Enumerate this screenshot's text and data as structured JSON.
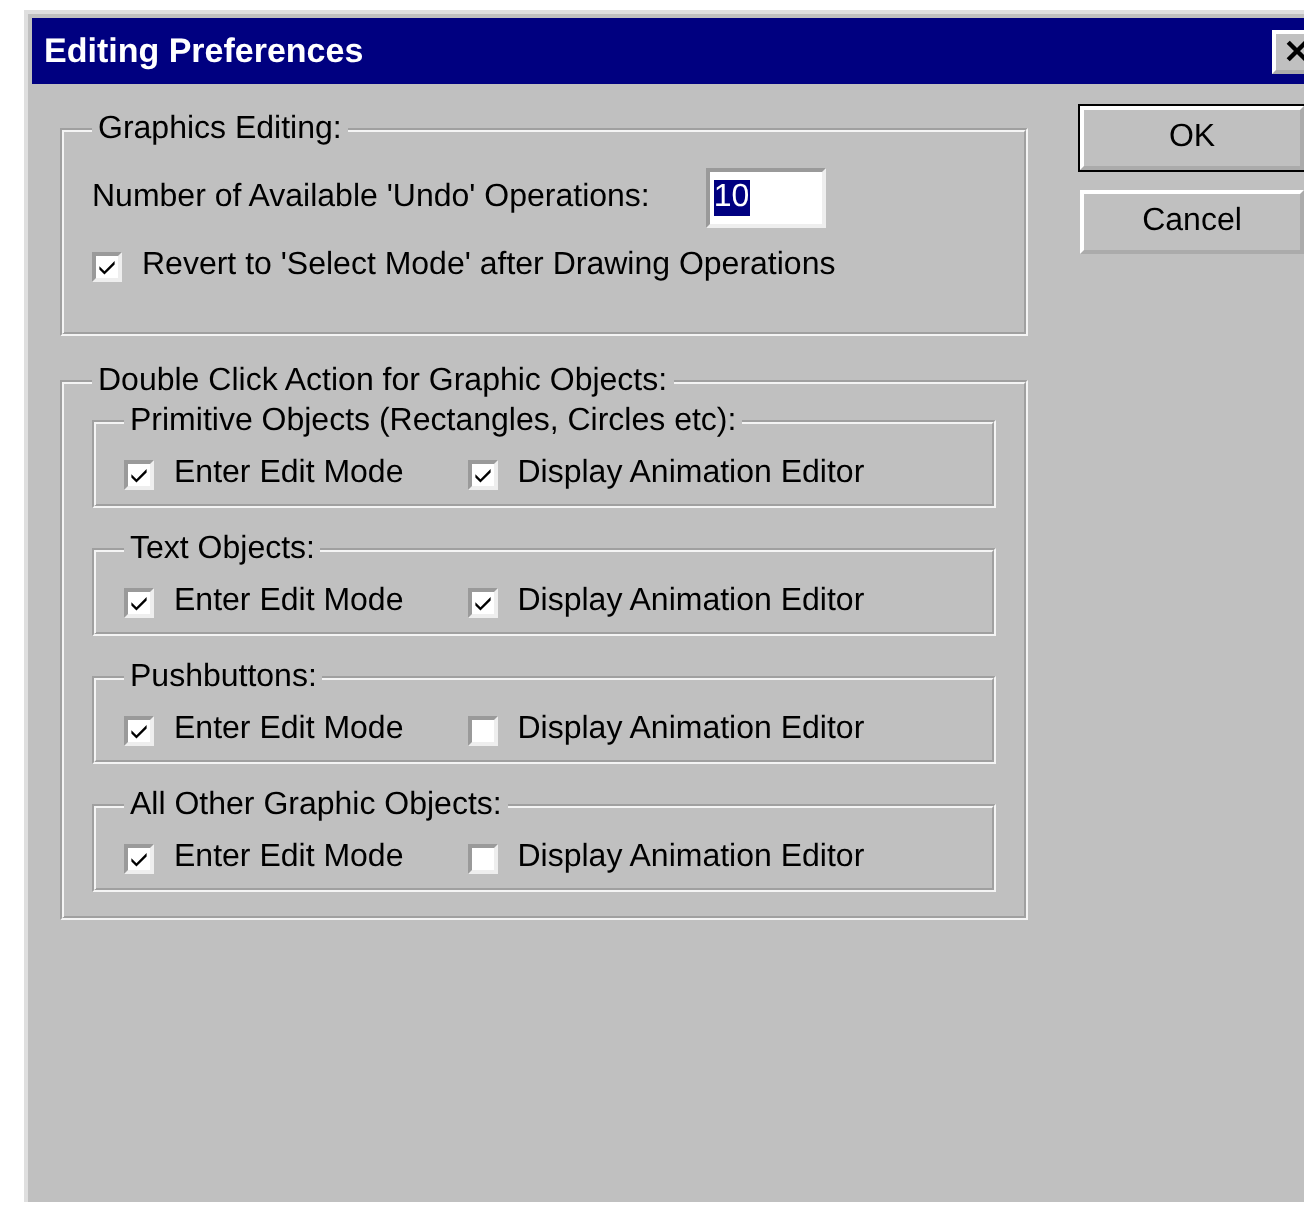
{
  "window": {
    "title": "Editing Preferences"
  },
  "graphics_editing": {
    "title": "Graphics Editing:",
    "undo_label": "Number of Available 'Undo' Operations:",
    "undo_value": "10",
    "undo_value_selected": true,
    "revert": {
      "label": "Revert to 'Select Mode' after Drawing Operations",
      "checked": true
    }
  },
  "double_click": {
    "title": "Double Click Action for Graphic Objects:",
    "groups": [
      {
        "title": "Primitive Objects (Rectangles, Circles etc):",
        "options": [
          {
            "label": "Enter Edit Mode",
            "checked": true
          },
          {
            "label": "Display Animation Editor",
            "checked": true
          }
        ]
      },
      {
        "title": "Text Objects:",
        "options": [
          {
            "label": "Enter Edit Mode",
            "checked": true
          },
          {
            "label": "Display Animation Editor",
            "checked": true
          }
        ]
      },
      {
        "title": "Pushbuttons:",
        "options": [
          {
            "label": "Enter Edit Mode",
            "checked": true
          },
          {
            "label": "Display Animation Editor",
            "checked": false
          }
        ]
      },
      {
        "title": "All Other Graphic Objects:",
        "options": [
          {
            "label": "Enter Edit Mode",
            "checked": true
          },
          {
            "label": "Display Animation Editor",
            "checked": false
          }
        ]
      }
    ]
  },
  "buttons": [
    "OK",
    "Cancel"
  ]
}
